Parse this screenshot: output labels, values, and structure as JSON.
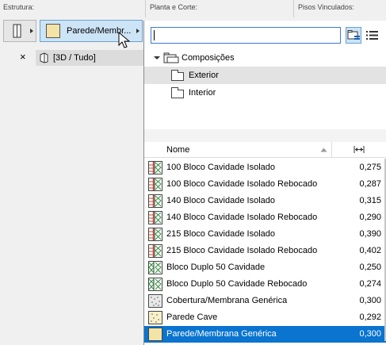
{
  "sections": {
    "estrutura": "Estrutura:",
    "planta": "Planta e Corte:",
    "pisos": "Pisos Vinculados:"
  },
  "composite_button": {
    "label": "Parede/Membr..."
  },
  "view_item": {
    "close": "×",
    "label": "[3D / Tudo]"
  },
  "tree": {
    "root": "Composições",
    "folders": [
      "Exterior",
      "Interior"
    ],
    "selected": "Exterior"
  },
  "list": {
    "header_name": "Nome",
    "header_thickness_icon": "thickness-icon",
    "rows": [
      {
        "name": "100 Bloco Cavidade Isolado",
        "value": "0,275",
        "icon": "brick-insulation"
      },
      {
        "name": "100 Bloco Cavidade Isolado Rebocado",
        "value": "0,287",
        "icon": "brick-insulation"
      },
      {
        "name": "140 Bloco Cavidade Isolado",
        "value": "0,315",
        "icon": "brick-insulation"
      },
      {
        "name": "140 Bloco Cavidade Isolado Rebocado",
        "value": "0,290",
        "icon": "brick-insulation"
      },
      {
        "name": "215 Bloco Cavidade Isolado",
        "value": "0,390",
        "icon": "brick-insulation"
      },
      {
        "name": "215 Bloco Cavidade Isolado Rebocado",
        "value": "0,402",
        "icon": "brick-insulation"
      },
      {
        "name": "Bloco Duplo 50 Cavidade",
        "value": "0,250",
        "icon": "double-block"
      },
      {
        "name": "Bloco Duplo 50 Cavidade Rebocado",
        "value": "0,274",
        "icon": "double-block"
      },
      {
        "name": "Cobertura/Membrana Genérica",
        "value": "0,300",
        "icon": "roof-membrane"
      },
      {
        "name": "Parede Cave",
        "value": "0,292",
        "icon": "basement"
      },
      {
        "name": "Parede/Membrana Genérica",
        "value": "0,300",
        "icon": "generic-wall"
      }
    ],
    "selected_index": 10
  },
  "colors": {
    "accent": "#0a74cf",
    "swatch": "#f3e3a6",
    "brick": "#c04a3a",
    "insulation": "#2f8f3a"
  }
}
